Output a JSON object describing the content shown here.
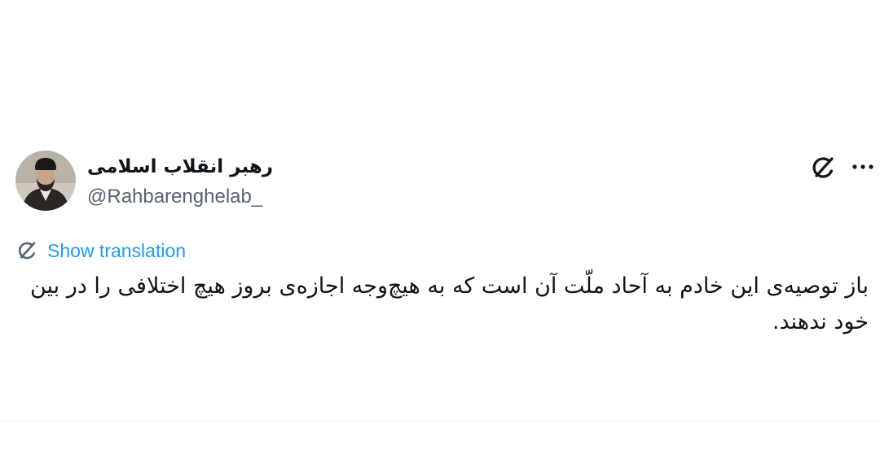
{
  "tweet": {
    "author": {
      "display_name": "رهبر انقلاب اسلامی",
      "handle": "@Rahbarenghelab_",
      "avatar_icon": "person-avatar"
    },
    "actions": {
      "grok_icon": "grok-icon",
      "more_icon": "more-dots-icon"
    },
    "translation": {
      "label": "Show translation",
      "icon": "grok-translate-icon"
    },
    "text": "باز توصیه‌ی این خادم به آحاد ملّت آن است که به هیچ‌وجه اجازه‌ی بروز هیچ اختلافی را در بین خود ندهند."
  },
  "colors": {
    "link": "#1d9bf0",
    "secondary_text": "#536471",
    "primary_text": "#0f1419",
    "divider": "#eff3f4"
  }
}
